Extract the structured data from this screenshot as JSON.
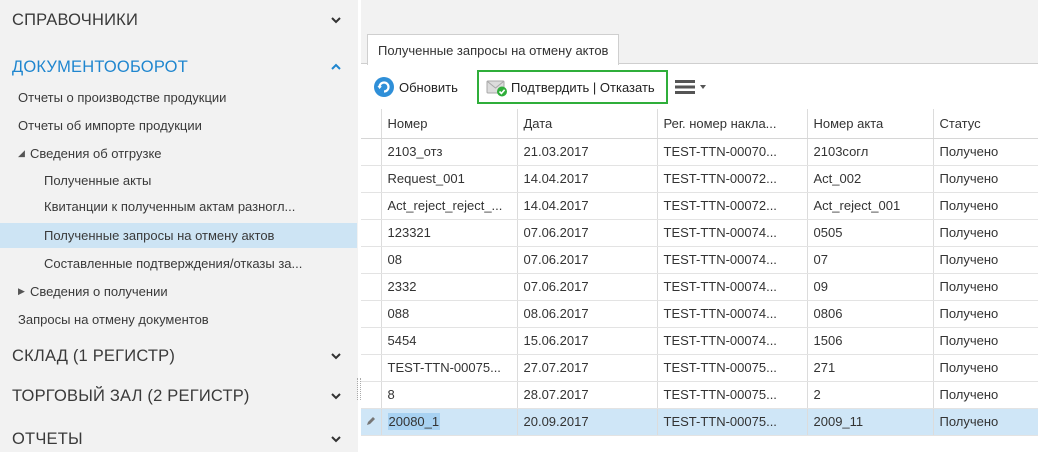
{
  "sidebar": {
    "sections": [
      {
        "label": "СПРАВОЧНИКИ",
        "expanded": false
      },
      {
        "label": "ДОКУМЕНТООБОРОТ",
        "expanded": true
      },
      {
        "label": "СКЛАД (1 РЕГИСТР)",
        "expanded": false
      },
      {
        "label": "ТОРГОВЫЙ ЗАЛ (2 РЕГИСТР)",
        "expanded": false
      },
      {
        "label": "ОТЧЕТЫ",
        "expanded": false
      }
    ],
    "items": [
      {
        "label": "Отчеты о производстве продукции",
        "level": 0
      },
      {
        "label": "Отчеты об импорте продукции",
        "level": 0
      },
      {
        "label": "Сведения об отгрузке",
        "level": 0,
        "toggle": "expanded"
      },
      {
        "label": "Полученные акты",
        "level": 1
      },
      {
        "label": "Квитанции к полученным актам разногл...",
        "level": 1
      },
      {
        "label": "Полученные запросы на отмену актов",
        "level": 1,
        "selected": true
      },
      {
        "label": "Составленные подтверждения/отказы за...",
        "level": 1
      },
      {
        "label": "Сведения о получении",
        "level": 0,
        "toggle": "collapsed"
      },
      {
        "label": "Запросы на отмену документов",
        "level": 0
      }
    ]
  },
  "tab": {
    "label": "Полученные запросы на отмену актов"
  },
  "toolbar": {
    "refresh_label": "Обновить",
    "confirm_label": "Подтвердить | Отказать",
    "refresh_icon": "refresh-icon",
    "confirm_icon": "envelope-check-icon",
    "menu_icon": "hamburger-menu-icon"
  },
  "grid": {
    "columns": [
      "Номер",
      "Дата",
      "Рег. номер накла...",
      "Номер акта",
      "Статус"
    ],
    "rows": [
      [
        "2103_отз",
        "21.03.2017",
        "TEST-TTN-00070...",
        "2103согл",
        "Получено"
      ],
      [
        "Request_001",
        "14.04.2017",
        "TEST-TTN-00072...",
        "Act_002",
        "Получено"
      ],
      [
        "Act_reject_reject_...",
        "14.04.2017",
        "TEST-TTN-00072...",
        "Act_reject_001",
        "Получено"
      ],
      [
        "123321",
        "07.06.2017",
        "TEST-TTN-00074...",
        "0505",
        "Получено"
      ],
      [
        "08",
        "07.06.2017",
        "TEST-TTN-00074...",
        "07",
        "Получено"
      ],
      [
        "2332",
        "07.06.2017",
        "TEST-TTN-00074...",
        "09",
        "Получено"
      ],
      [
        "088",
        "08.06.2017",
        "TEST-TTN-00074...",
        "0806",
        "Получено"
      ],
      [
        "5454",
        "15.06.2017",
        "TEST-TTN-00074...",
        "1506",
        "Получено"
      ],
      [
        "TEST-TTN-00075...",
        "27.07.2017",
        "TEST-TTN-00075...",
        "271",
        "Получено"
      ],
      [
        "8",
        "28.07.2017",
        "TEST-TTN-00075...",
        "2",
        "Получено"
      ],
      [
        "20080_1",
        "20.09.2017",
        "TEST-TTN-00075...",
        "2009_11",
        "Получено"
      ]
    ],
    "selected_row": 10,
    "colors": {
      "selection": "#cfe6f7",
      "highlight_border": "#2fae3a",
      "accent": "#1f86cf"
    }
  }
}
